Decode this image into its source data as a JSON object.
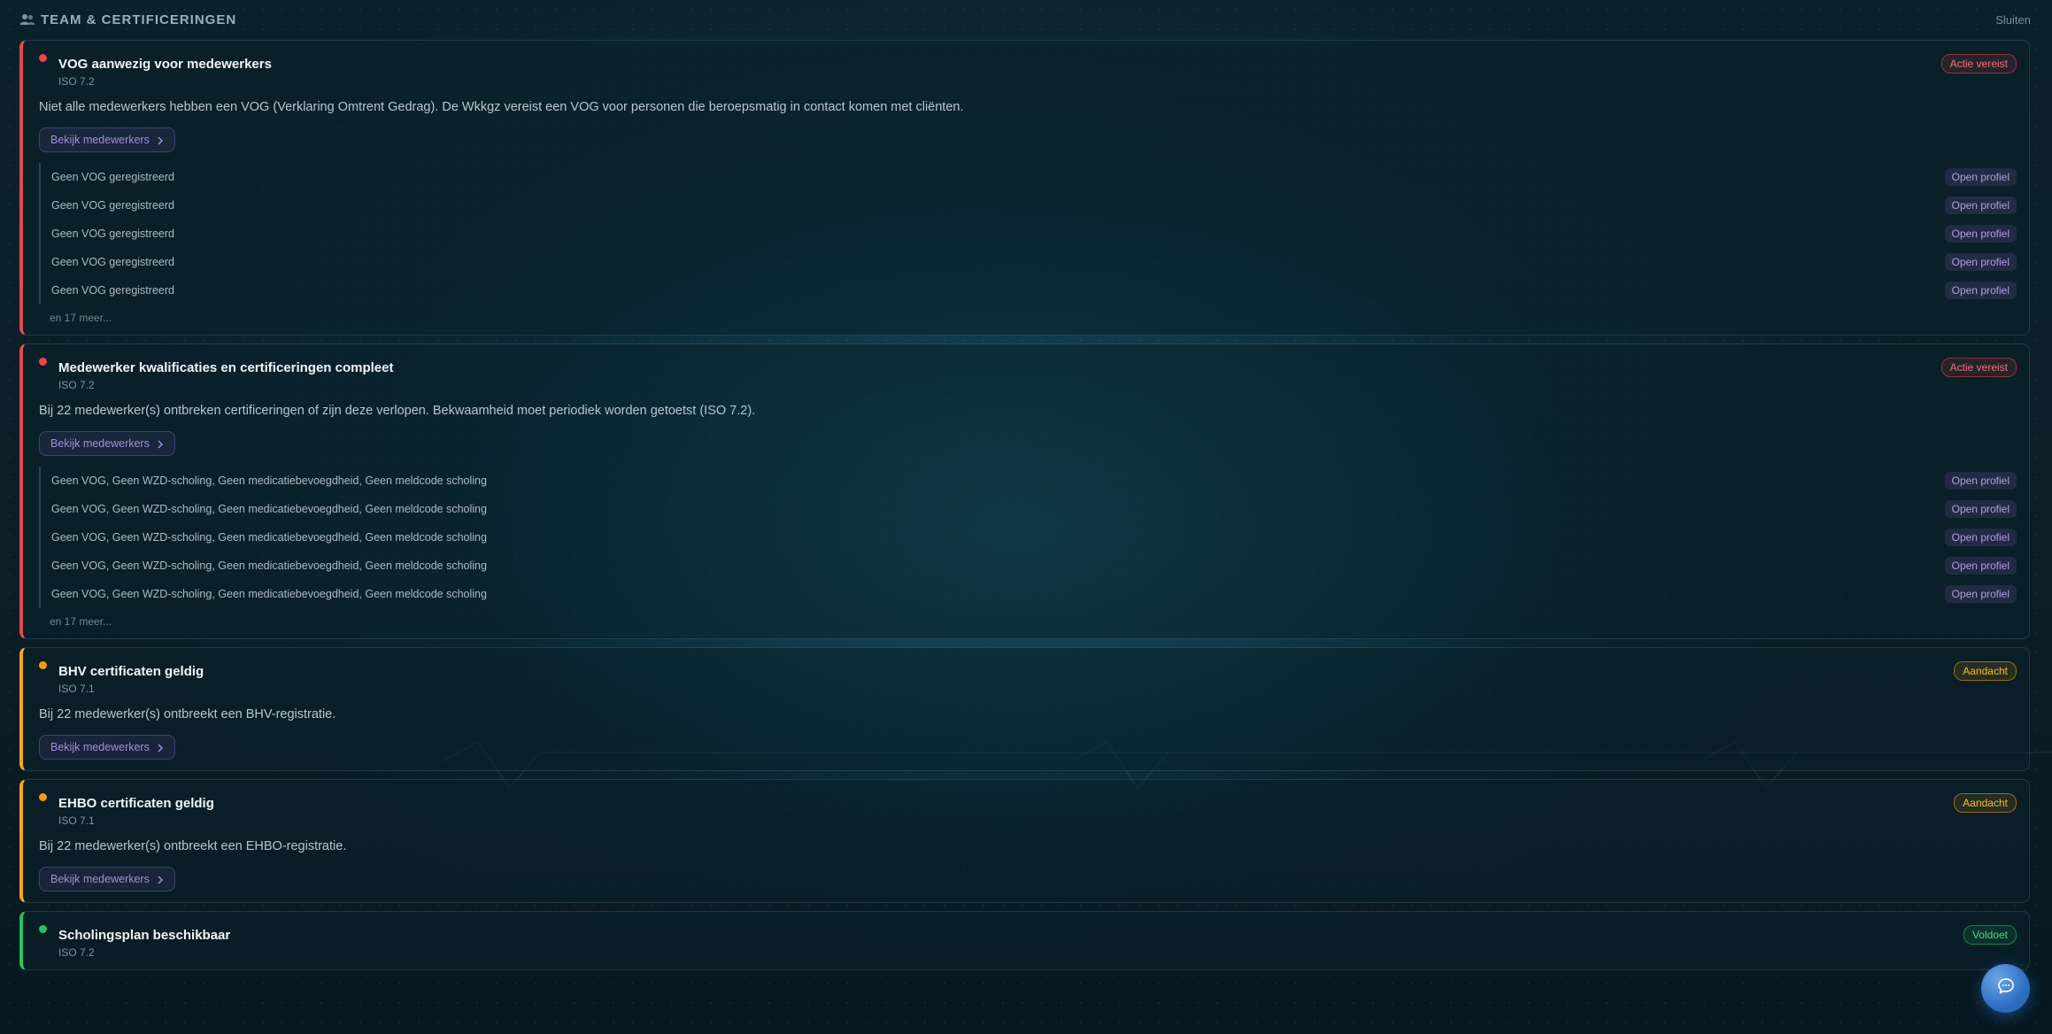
{
  "header": {
    "title": "TEAM & CERTIFICERINGEN",
    "close_label": "Sluiten"
  },
  "colors": {
    "critical": "#e5484d",
    "warning": "#f5a524",
    "ok": "#22c55e",
    "accent": "#a78bda"
  },
  "cards": [
    {
      "title": "VOG aanwezig voor medewerkers",
      "iso": "ISO 7.2",
      "status": "Actie vereist",
      "description": "Niet alle medewerkers hebben een VOG (Verklaring Omtrent Gedrag). De Wkkgz vereist een VOG voor personen die beroepsmatig in contact komen met cliënten.",
      "button_label": "Bekijk medewerkers",
      "rows": [
        {
          "text": "Geen VOG geregistreerd",
          "action": "Open profiel"
        },
        {
          "text": "Geen VOG geregistreerd",
          "action": "Open profiel"
        },
        {
          "text": "Geen VOG geregistreerd",
          "action": "Open profiel"
        },
        {
          "text": "Geen VOG geregistreerd",
          "action": "Open profiel"
        },
        {
          "text": "Geen VOG geregistreerd",
          "action": "Open profiel"
        }
      ],
      "more": "en 17 meer..."
    },
    {
      "title": "Medewerker kwalificaties en certificeringen compleet",
      "iso": "ISO 7.2",
      "status": "Actie vereist",
      "description": "Bij 22 medewerker(s) ontbreken certificeringen of zijn deze verlopen. Bekwaamheid moet periodiek worden getoetst (ISO 7.2).",
      "button_label": "Bekijk medewerkers",
      "rows": [
        {
          "text": "Geen VOG, Geen WZD-scholing, Geen medicatiebevoegdheid, Geen meldcode scholing",
          "action": "Open profiel"
        },
        {
          "text": "Geen VOG, Geen WZD-scholing, Geen medicatiebevoegdheid, Geen meldcode scholing",
          "action": "Open profiel"
        },
        {
          "text": "Geen VOG, Geen WZD-scholing, Geen medicatiebevoegdheid, Geen meldcode scholing",
          "action": "Open profiel"
        },
        {
          "text": "Geen VOG, Geen WZD-scholing, Geen medicatiebevoegdheid, Geen meldcode scholing",
          "action": "Open profiel"
        },
        {
          "text": "Geen VOG, Geen WZD-scholing, Geen medicatiebevoegdheid, Geen meldcode scholing",
          "action": "Open profiel"
        }
      ],
      "more": "en 17 meer..."
    },
    {
      "title": "BHV certificaten geldig",
      "iso": "ISO 7.1",
      "status": "Aandacht",
      "description": "Bij 22 medewerker(s) ontbreekt een BHV-registratie.",
      "button_label": "Bekijk medewerkers"
    },
    {
      "title": "EHBO certificaten geldig",
      "iso": "ISO 7.1",
      "status": "Aandacht",
      "description": "Bij 22 medewerker(s) ontbreekt een EHBO-registratie.",
      "button_label": "Bekijk medewerkers"
    },
    {
      "title": "Scholingsplan beschikbaar",
      "iso": "ISO 7.2",
      "status": "Voldoet"
    }
  ],
  "fab": {
    "icon": "chat-icon"
  }
}
